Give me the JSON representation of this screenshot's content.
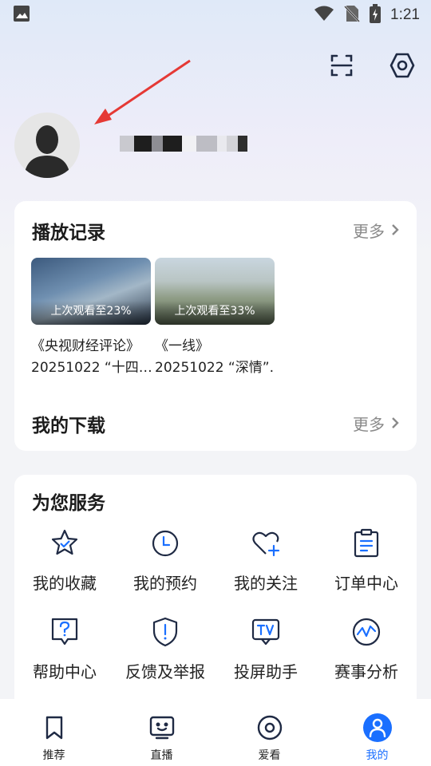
{
  "status_bar": {
    "time": "1:21",
    "icons": [
      "image-icon",
      "wifi-icon",
      "no-sim-icon",
      "battery-charging-icon"
    ]
  },
  "header": {
    "icons": [
      "scan-icon",
      "settings-icon"
    ],
    "avatar_icon": "avatar-placeholder-icon"
  },
  "history": {
    "title": "播放记录",
    "more": "更多",
    "items": [
      {
        "progress": "上次观看至23%",
        "title": "《央视财经评论》",
        "subtitle": "20251022 “十四…"
      },
      {
        "progress": "上次观看至33%",
        "title": "《一线》",
        "subtitle": "20251022 “深情”…"
      }
    ]
  },
  "downloads": {
    "title": "我的下载",
    "more": "更多"
  },
  "services": {
    "title": "为您服务",
    "items": [
      {
        "label": "我的收藏",
        "icon": "favorite-star-icon"
      },
      {
        "label": "我的预约",
        "icon": "clock-icon"
      },
      {
        "label": "我的关注",
        "icon": "heart-plus-icon"
      },
      {
        "label": "订单中心",
        "icon": "clipboard-icon"
      },
      {
        "label": "帮助中心",
        "icon": "help-chat-icon"
      },
      {
        "label": "反馈及举报",
        "icon": "shield-alert-icon"
      },
      {
        "label": "投屏助手",
        "icon": "tv-cast-icon"
      },
      {
        "label": "赛事分析",
        "icon": "chart-circle-icon"
      }
    ]
  },
  "tabbar": {
    "tabs": [
      {
        "label": "推荐",
        "icon": "bookmark-icon",
        "active": false
      },
      {
        "label": "直播",
        "icon": "tv-smile-icon",
        "active": false
      },
      {
        "label": "爱看",
        "icon": "target-icon",
        "active": false
      },
      {
        "label": "我的",
        "icon": "user-icon",
        "active": true
      }
    ]
  },
  "colors": {
    "accent": "#1a6fff",
    "annotation_arrow": "#e53935",
    "icon_dark": "#1f2a44"
  }
}
